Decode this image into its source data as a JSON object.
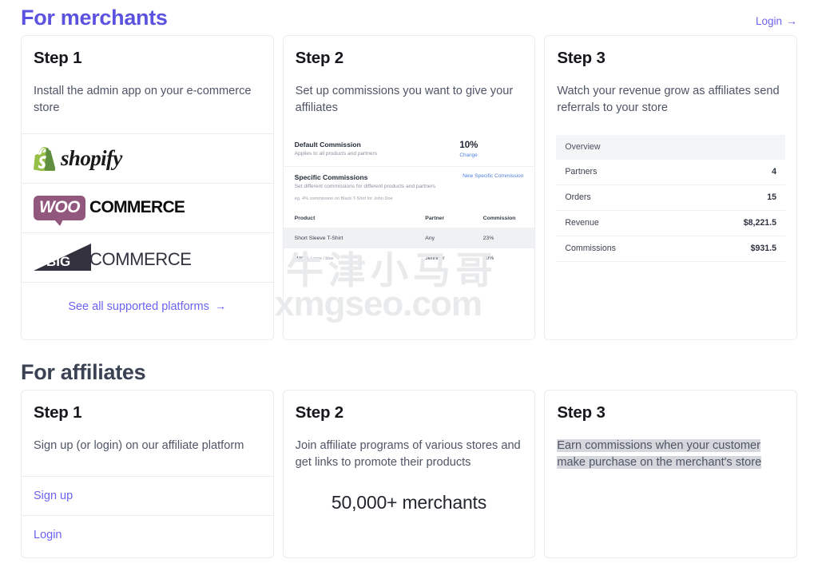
{
  "merchants": {
    "section_title": "For merchants",
    "login_label": "Login",
    "login_arrow": "→",
    "cards": [
      {
        "step": "Step 1",
        "desc": "Install the admin app on your e-commerce store",
        "platforms": [
          {
            "name": "shopify-logo",
            "word": "shopify"
          },
          {
            "name": "woocommerce-logo",
            "badge": "WOO",
            "word": "COMMERCE"
          },
          {
            "name": "bigcommerce-logo",
            "inline": "BIG",
            "word": "COMMERCE"
          }
        ],
        "see_all_label": "See all supported platforms",
        "see_all_arrow": "→"
      },
      {
        "step": "Step 2",
        "desc": "Set up commissions you want to give your affiliates",
        "panel": {
          "default_title": "Default Commission",
          "default_sub": "Applies to all products and partners",
          "default_value": "10%",
          "change_label": "Change",
          "specific_title": "Specific Commissions",
          "specific_sub": "Set different commissions for different products and partners",
          "specific_eg": "eg. 4% commission on Black T-Shirt for John Doe",
          "new_link": "New Specific Commission",
          "columns": [
            "Product",
            "Partner",
            "Commission"
          ],
          "rows": [
            {
              "product": "Short Sleeve T-Shirt",
              "variant": "",
              "partner": "Any",
              "commission": "23%"
            },
            {
              "product": "Pants",
              "variant": "Large / blue",
              "partner": "Jennifer",
              "commission": "50%"
            }
          ]
        }
      },
      {
        "step": "Step 3",
        "desc": "Watch your revenue grow as affiliates send referrals to your store",
        "overview": {
          "header": "Overview",
          "rows": [
            {
              "label": "Partners",
              "value": "4"
            },
            {
              "label": "Orders",
              "value": "15"
            },
            {
              "label": "Revenue",
              "value": "$8,221.5"
            },
            {
              "label": "Commissions",
              "value": "$931.5"
            }
          ]
        }
      }
    ]
  },
  "affiliates": {
    "section_title": "For affiliates",
    "cards": [
      {
        "step": "Step 1",
        "desc": "Sign up (or login) on our affiliate platform",
        "signup_label": "Sign up",
        "login_label": "Login"
      },
      {
        "step": "Step 2",
        "desc": "Join affiliate programs of various stores and get links to promote their products",
        "merchant_count": "50,000+ merchants"
      },
      {
        "step": "Step 3",
        "desc": "Earn commissions when your customer make purchase on the merchant's store"
      }
    ]
  },
  "watermark": {
    "cn": "牛津小马哥",
    "en": "xmgseo.com"
  },
  "colors": {
    "brand": "#5b53e0",
    "link": "#6c63f0",
    "table_link": "#4f7fe0",
    "dark_title": "#3b4254",
    "selection": "#d5d7dc"
  }
}
